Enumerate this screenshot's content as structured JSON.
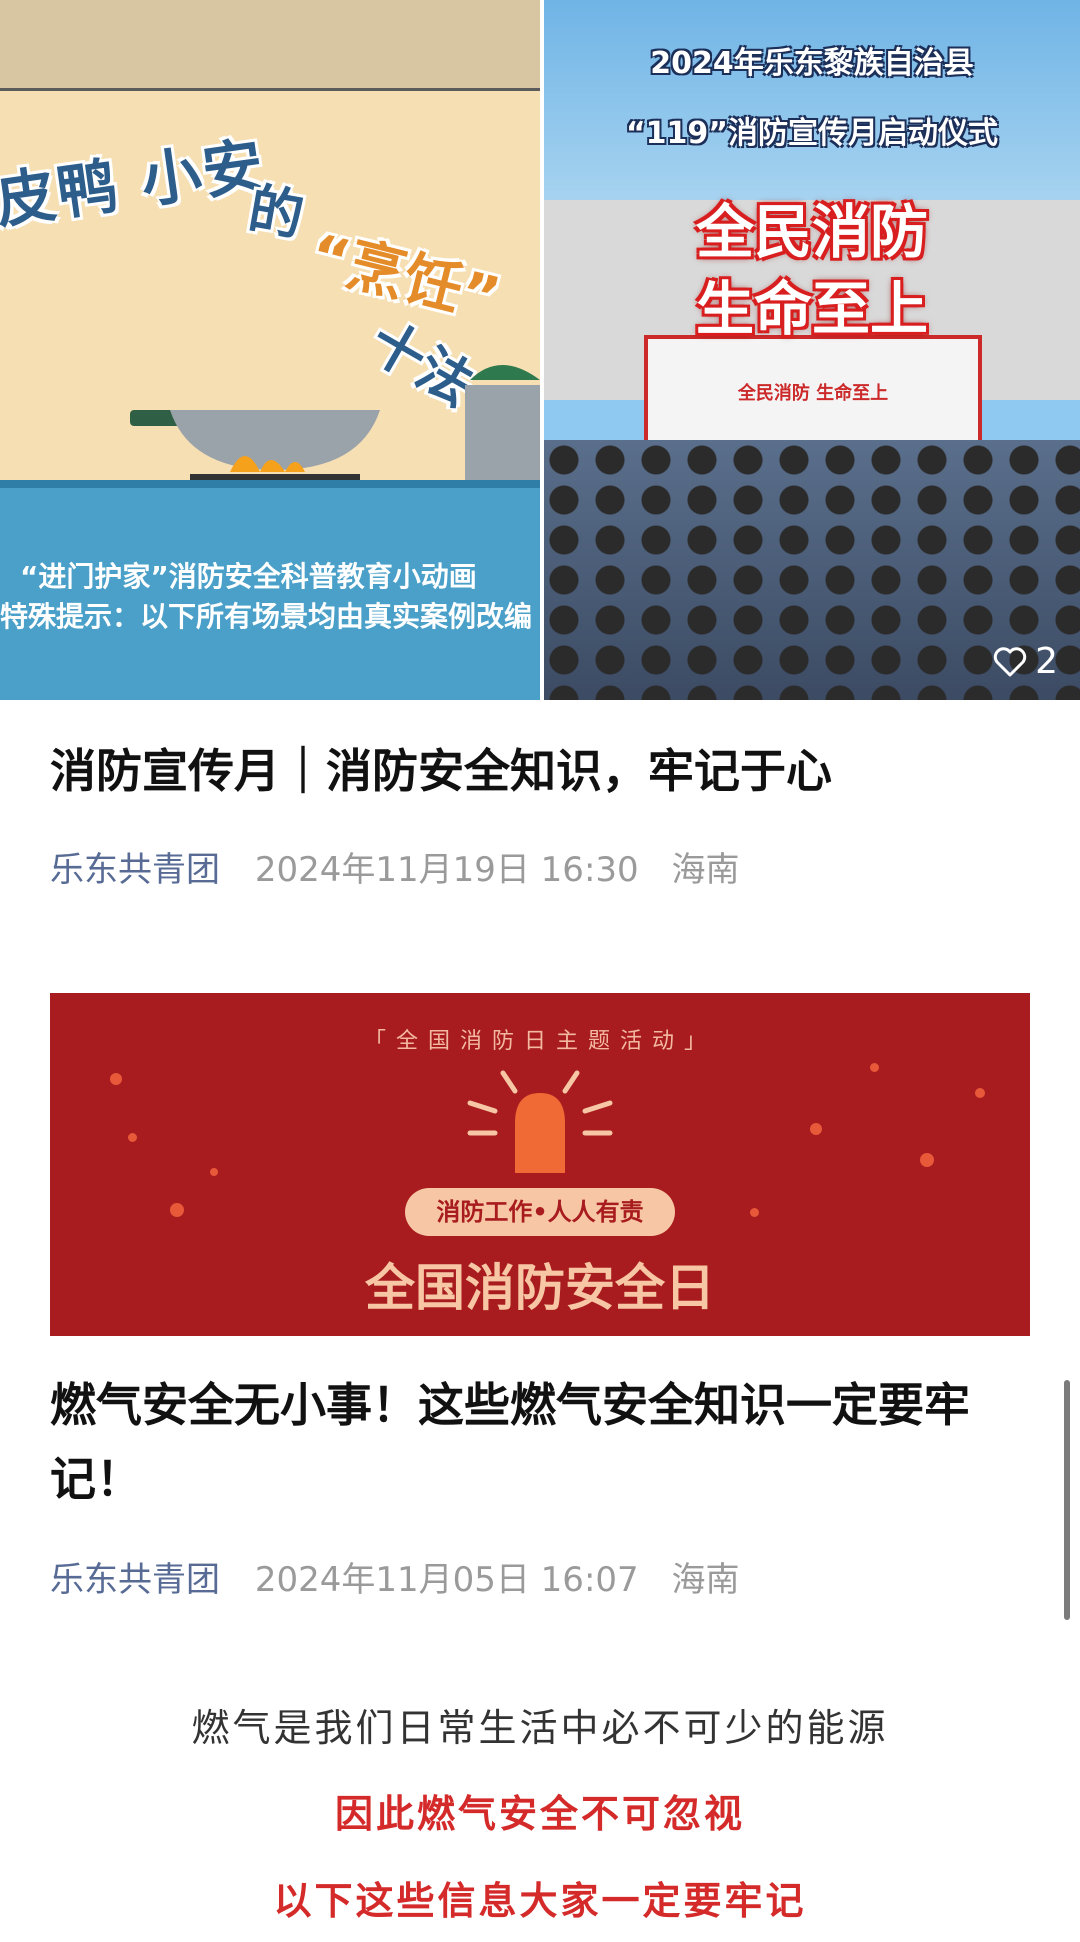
{
  "images": {
    "left": {
      "headline": "皮鸭 小安",
      "de": "的",
      "pengren": "“烹饪”",
      "shifa": "十法",
      "caption_line1": "“进门护家”消防安全科普教育小动画",
      "caption_line2": "特殊提示：以下所有场景均由真实案例改编"
    },
    "right": {
      "title_line1": "2024年乐东黎族自治县",
      "title_line2": "“119”消防宣传月启动仪式",
      "slogan_line1": "全民消防",
      "slogan_line2": "生命至上",
      "stage_text": "全民消防    生命至上",
      "like_count": "2"
    }
  },
  "article1": {
    "title": "消防宣传月｜消防安全知识，牢记于心",
    "source": "乐东共青团",
    "date": "2024年11月19日 16:30",
    "location": "海南"
  },
  "banner": {
    "tag": "「全国消防日主题活动」",
    "pill": "消防工作•人人有责",
    "main": "全国消防安全日",
    "colors": {
      "background": "#a81c1f",
      "accent": "#f7c6a4"
    }
  },
  "article2": {
    "title": "燃气安全无小事！这些燃气安全知识一定要牢记！",
    "source": "乐东共青团",
    "date": "2024年11月05日 16:07",
    "location": "海南",
    "body_lines": [
      "燃气是我们日常生活中必不可少的能源",
      "因此燃气安全不可忽视",
      "以下这些信息大家一定要牢记"
    ]
  }
}
